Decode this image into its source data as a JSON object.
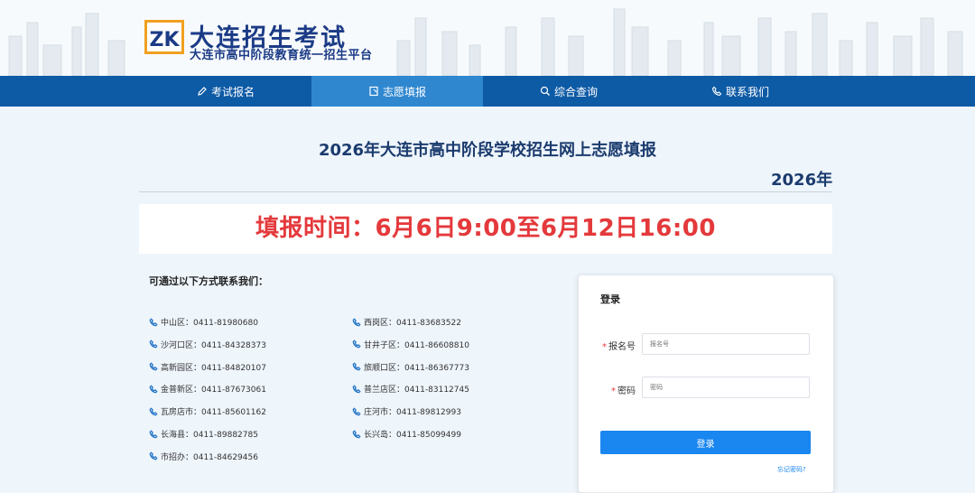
{
  "header": {
    "logo_title": "大连招生考试",
    "logo_subtitle": "大连市高中阶段教育统一招生平台"
  },
  "nav": [
    {
      "label": "考试报名",
      "icon": "pencil-icon"
    },
    {
      "label": "志愿填报",
      "icon": "document-icon",
      "active": true
    },
    {
      "label": "综合查询",
      "icon": "search-icon"
    },
    {
      "label": "联系我们",
      "icon": "phone-icon"
    }
  ],
  "main": {
    "title": "2026年大连市高中阶段学校招生网上志愿填报",
    "year": "2026年",
    "banner": "填报时间：6月6日9:00至6月12日16:00"
  },
  "contacts": {
    "title": "可通过以下方式联系我们：",
    "items": [
      {
        "text": "中山区：0411-81980680"
      },
      {
        "text": "西岗区：0411-83683522"
      },
      {
        "text": "沙河口区：0411-84328373"
      },
      {
        "text": "甘井子区：0411-86608810"
      },
      {
        "text": "高新园区：0411-84820107"
      },
      {
        "text": "旅顺口区：0411-86367773"
      },
      {
        "text": "金普新区：0411-87673061"
      },
      {
        "text": "普兰店区：0411-83112745"
      },
      {
        "text": "瓦房店市：0411-85601162"
      },
      {
        "text": "庄河市：0411-89812993"
      },
      {
        "text": "长海县：0411-89882785"
      },
      {
        "text": "长兴岛：0411-85099499"
      },
      {
        "text": "市招办：0411-84629456"
      }
    ]
  },
  "login": {
    "title": "登录",
    "username_label": "报名号",
    "username_placeholder": "报名号",
    "password_label": "密码",
    "password_placeholder": "密码",
    "submit_label": "登录",
    "forgot_label": "忘记密码?"
  },
  "colors": {
    "nav_bg": "#0d5aa5",
    "nav_active": "#2f87d0",
    "banner_text": "#e4393c",
    "button": "#1a86f0",
    "title_text": "#1b3b6e"
  }
}
